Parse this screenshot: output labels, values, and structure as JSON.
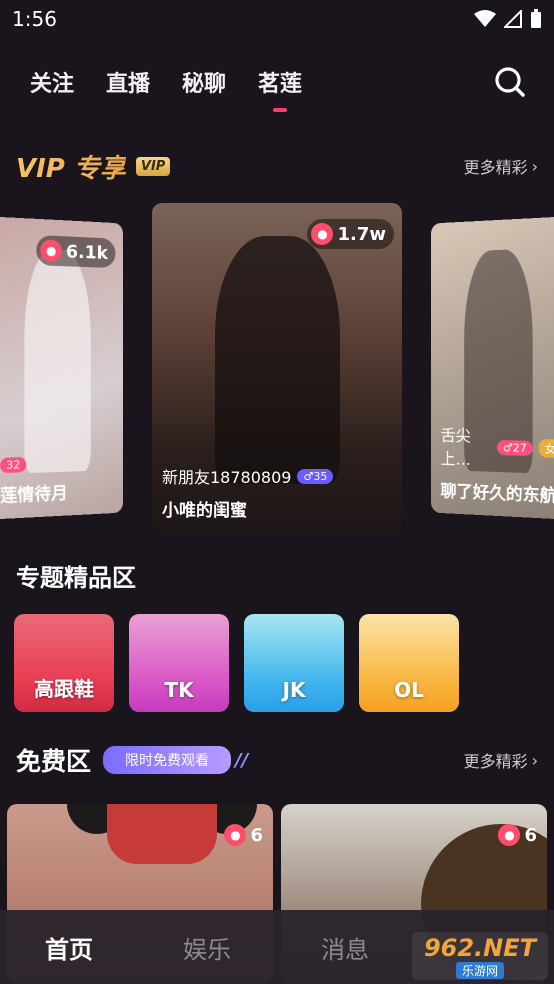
{
  "status_bar": {
    "time": "1:56"
  },
  "top_tabs": [
    {
      "label": "关注"
    },
    {
      "label": "直播"
    },
    {
      "label": "秘聊"
    },
    {
      "label": "茗莲",
      "active": true
    }
  ],
  "vip": {
    "title": "VIP 专享",
    "badge": "VIP",
    "more": "更多精彩",
    "cards": [
      {
        "views": "6.1k",
        "age": "32",
        "title": "莲情待月"
      },
      {
        "views": "1.7w",
        "name": "新朋友18780809",
        "age": "♂35",
        "title": "小唯的闺蜜"
      },
      {
        "views": "",
        "name": "舌尖上…",
        "age": "♂27",
        "age2": "女",
        "title": "聊了好久的东航空姐"
      }
    ]
  },
  "topics": {
    "title": "专题精品区",
    "items": [
      "高跟鞋",
      "TK",
      "JK",
      "OL"
    ]
  },
  "free": {
    "title": "免费区",
    "tag": "限时免费观看",
    "more": "更多精彩",
    "cards": [
      {
        "views": "6"
      },
      {
        "views": "6"
      }
    ]
  },
  "bottom_nav": [
    "首页",
    "娱乐",
    "消息"
  ],
  "watermark": {
    "big": "962.NET",
    "small": "乐游网"
  },
  "colors": {
    "accent": "#ff3b6b",
    "vip_gold": "#f6c36a",
    "free_tag": "#7b6cff"
  }
}
